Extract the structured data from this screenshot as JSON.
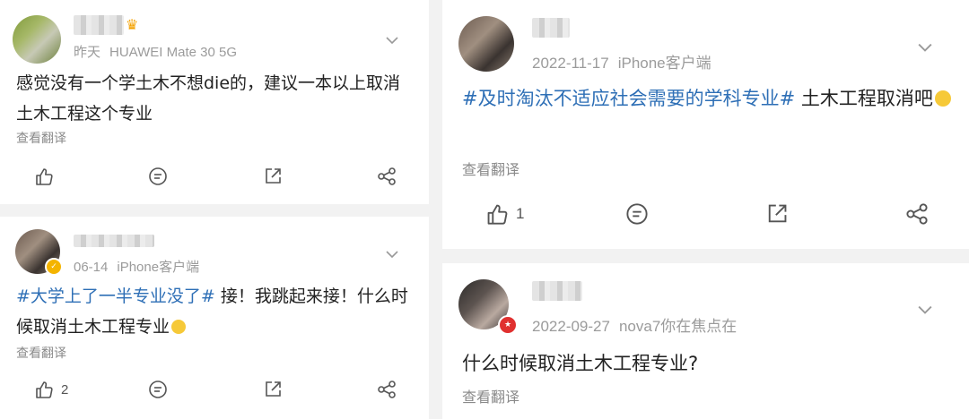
{
  "left": {
    "post1": {
      "meta_time": "昨天",
      "meta_source": "HUAWEI Mate 30 5G",
      "text": "感觉没有一个学土木不想die的，建议一本以上取消土木工程这个专业",
      "translate": "查看翻译",
      "like_count": "",
      "icons": [
        "like-icon",
        "comment-icon",
        "share-icon",
        "more-share-icon"
      ]
    },
    "post2": {
      "meta_time": "06-14",
      "meta_source": "iPhone客户端",
      "hashtag": "#大学上了一半专业没了#",
      "text": " 接！我跳起来接！什么时候取消土木工程专业",
      "translate": "查看翻译",
      "like_count": "2"
    }
  },
  "right": {
    "post1": {
      "meta_time": "2022-11-17",
      "meta_source": "iPhone客户端",
      "hashtag": "#及时淘汰不适应社会需要的学科专业#",
      "text": " 土木工程取消吧",
      "translate": "查看翻译",
      "like_count": "1"
    },
    "post2": {
      "meta_time": "2022-09-27",
      "meta_source": "nova7你在焦点在",
      "text": "什么时候取消土木工程专业?",
      "translate": "查看翻译"
    }
  },
  "colors": {
    "hashtag": "#2e6fb6",
    "meta": "#9b9b9b",
    "badge_gold": "#f4b400",
    "badge_red": "#e0302f"
  }
}
